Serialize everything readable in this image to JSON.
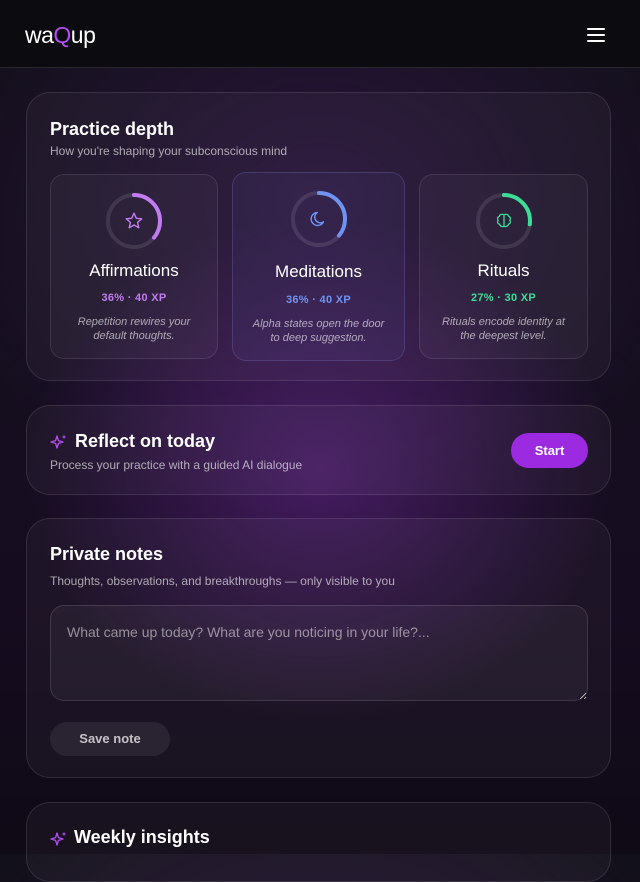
{
  "header": {
    "logo_prefix": "wa",
    "logo_accent": "Q",
    "logo_suffix": "up",
    "menu_icon": "hamburger-menu-icon"
  },
  "practice": {
    "title": "Practice depth",
    "subtitle": "How you're shaping your subconscious mind",
    "items": [
      {
        "name": "Affirmations",
        "stats": "36% · 40 XP",
        "progress": 0.36,
        "desc": "Repetition rewires your default thoughts.",
        "color": "#c07cf0",
        "icon": "star-icon"
      },
      {
        "name": "Meditations",
        "stats": "36% · 40 XP",
        "progress": 0.36,
        "desc": "Alpha states open the door to deep suggestion.",
        "color": "#6f93f2",
        "icon": "moon-icon"
      },
      {
        "name": "Rituals",
        "stats": "27% · 30 XP",
        "progress": 0.27,
        "desc": "Rituals encode identity at the deepest level.",
        "color": "#3ddc97",
        "icon": "brain-icon"
      }
    ]
  },
  "reflect": {
    "icon": "sparkles-icon",
    "title": "Reflect on today",
    "subtitle": "Process your practice with a guided AI dialogue",
    "button": "Start"
  },
  "notes": {
    "title": "Private notes",
    "subtitle": "Thoughts, observations, and breakthroughs — only visible to you",
    "placeholder": "What came up today? What are you noticing in your life?...",
    "value": "",
    "button": "Save note"
  },
  "weekly": {
    "icon": "sparkles-icon",
    "title": "Weekly insights"
  },
  "colors": {
    "accent": "#9b2ae0",
    "logo_accent": "#b44ef0"
  }
}
